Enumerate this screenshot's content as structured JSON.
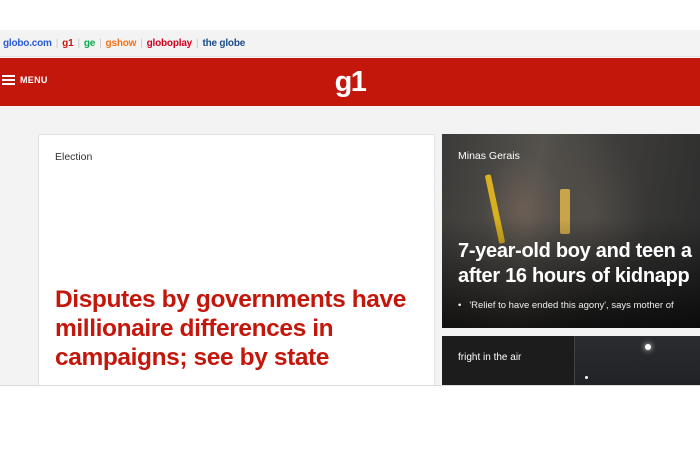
{
  "globo_bar": {
    "links": [
      {
        "label": "globo.com",
        "color": "#2a5bd7"
      },
      {
        "label": "g1",
        "color": "#c4170c"
      },
      {
        "label": "ge",
        "color": "#06aa48"
      },
      {
        "label": "gshow",
        "color": "#f47216"
      },
      {
        "label": "globoplay",
        "color": "#d2001f"
      },
      {
        "label": "the globe",
        "color": "#1a4b8c"
      }
    ],
    "separator": "|"
  },
  "header": {
    "menu_label": "MENU",
    "logo": "g1",
    "color": "#c4170c"
  },
  "main_story": {
    "section": "Election",
    "headline": "Disputes by governments have millionaire differences in campaigns; see by state"
  },
  "photo_story": {
    "section": "Minas Gerais",
    "headline_line1": "7-year-old boy and teen a",
    "headline_line2": "after 16 hours of kidnapp",
    "related": "'Relief to have ended this agony', says mother of"
  },
  "small_story": {
    "label": "fright in the air"
  }
}
